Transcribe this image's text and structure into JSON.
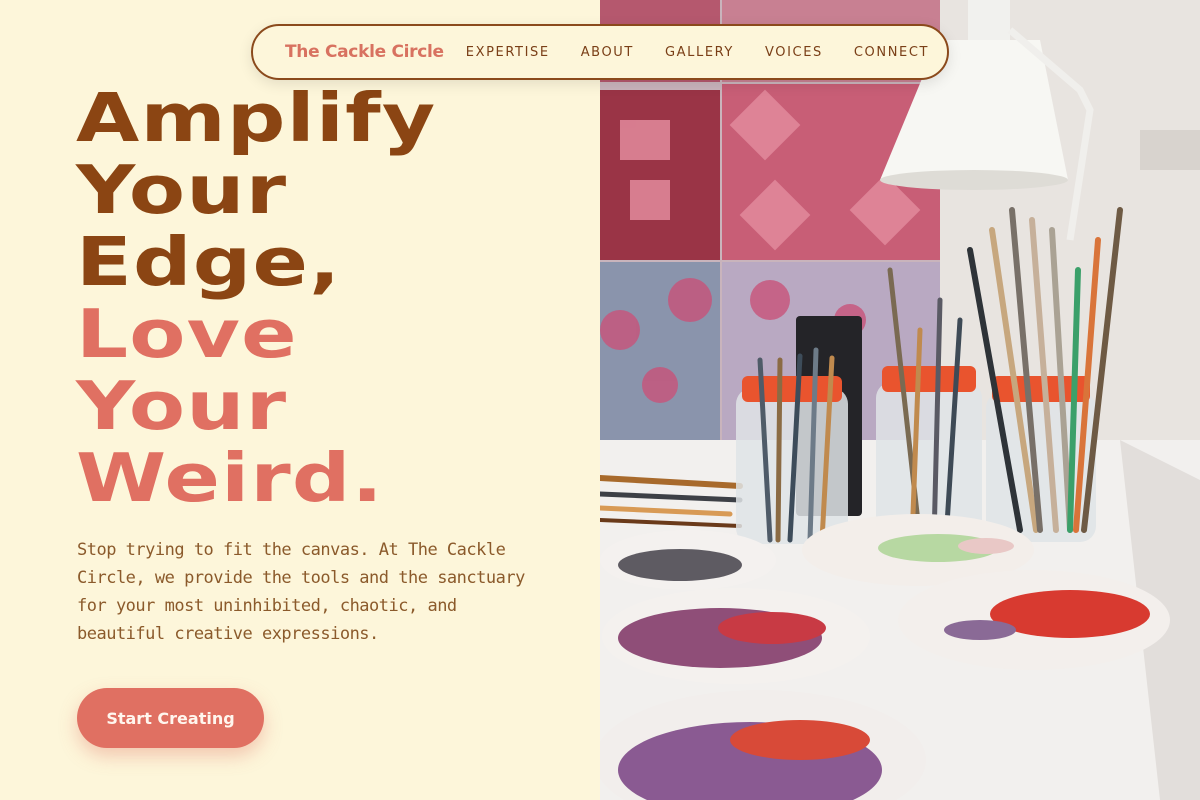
{
  "nav": {
    "brand": "The Cackle Circle",
    "items": [
      "EXPERTISE",
      "ABOUT",
      "GALLERY",
      "VOICES",
      "CONNECT"
    ]
  },
  "hero": {
    "headline_brown": [
      "Amplify",
      "Your",
      "Edge,"
    ],
    "headline_coral": [
      "Love",
      "Your",
      "Weird."
    ],
    "subtext": "Stop trying to fit the canvas. At The Cackle Circle, we provide the tools and the sanctuary for your most uninhibited, chaotic, and beautiful creative expressions.",
    "cta_label": "Start Creating"
  },
  "image": {
    "subject": "art studio table with paintbrush jars, palette bowls and white desk lamp"
  },
  "colors": {
    "background": "#fdf6da",
    "brown": "#8b4513",
    "coral": "#e07062",
    "text": "#8b5a2b"
  }
}
